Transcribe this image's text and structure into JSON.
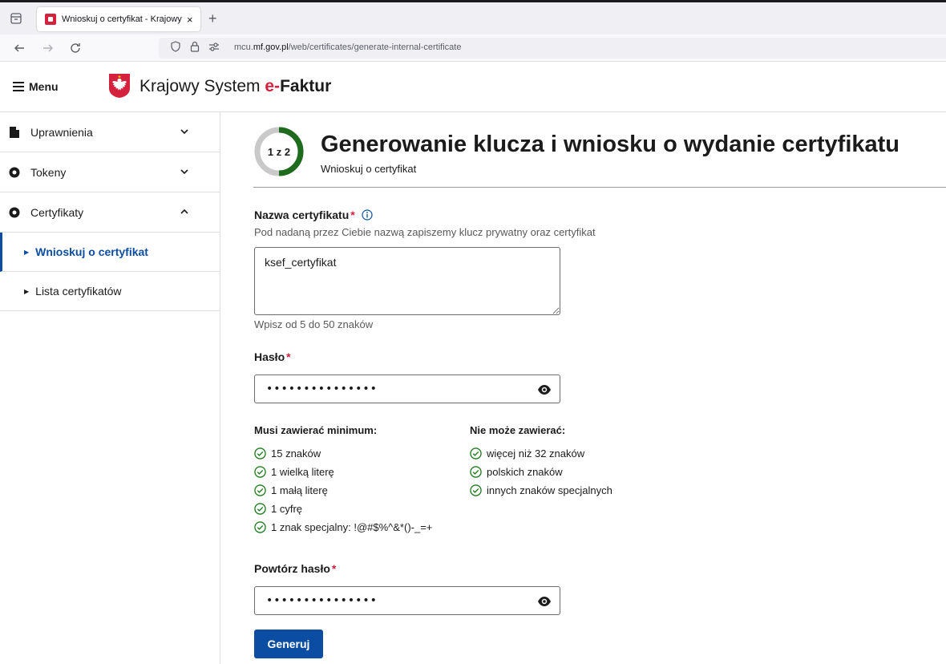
{
  "browser": {
    "tab_title": "Wnioskuj o certyfikat - Krajowy",
    "tab_close": "×",
    "new_tab": "+",
    "url_host_prefix": "mcu.",
    "url_host_domain": "mf.gov.pl",
    "url_path": "/web/certificates/generate-internal-certificate"
  },
  "header": {
    "menu_label": "Menu",
    "brand_prefix": "Krajowy System ",
    "brand_e": "e-",
    "brand_f": "Faktur"
  },
  "sidebar": {
    "items": [
      {
        "label": "Uprawnienia",
        "icon": "document-icon",
        "expanded": false
      },
      {
        "label": "Tokeny",
        "icon": "circle-icon",
        "expanded": false
      },
      {
        "label": "Certyfikaty",
        "icon": "circle-icon",
        "expanded": true
      }
    ],
    "subitems": [
      {
        "label": "Wnioskuj o certyfikat",
        "active": true
      },
      {
        "label": "Lista certyfikatów",
        "active": false
      }
    ]
  },
  "main": {
    "step_label": "1 z 2",
    "title": "Generowanie klucza i wniosku o wydanie certyfikatu",
    "subtitle": "Wnioskuj o certyfikat",
    "cert_name": {
      "label": "Nazwa certyfikatu",
      "required_mark": "*",
      "description": "Pod nadaną przez Ciebie nazwą zapiszemy klucz prywatny oraz certyfikat",
      "value": "ksef_certyfikat",
      "hint": "Wpisz od 5 do 50 znaków"
    },
    "password": {
      "label": "Hasło",
      "required_mark": "*",
      "masked_value": "•••••••••••••••"
    },
    "rules_must": {
      "heading": "Musi zawierać minimum:",
      "items": [
        "15 znaków",
        "1 wielką literę",
        "1 małą literę",
        "1 cyfrę",
        "1 znak specjalny: !@#$%^&*()-_=+"
      ]
    },
    "rules_cannot": {
      "heading": "Nie może zawierać:",
      "items": [
        "więcej niż 32 znaków",
        "polskich znaków",
        "innych znaków specjalnych"
      ]
    },
    "password_repeat": {
      "label": "Powtórz hasło",
      "required_mark": "*",
      "masked_value": "•••••••••••••••"
    },
    "generate_button": "Generuj"
  },
  "colors": {
    "accent_blue": "#0b4da2",
    "required_red": "#d4213d",
    "success_green": "#1e7b1e",
    "step_progress_green": "#1e6b1e"
  }
}
